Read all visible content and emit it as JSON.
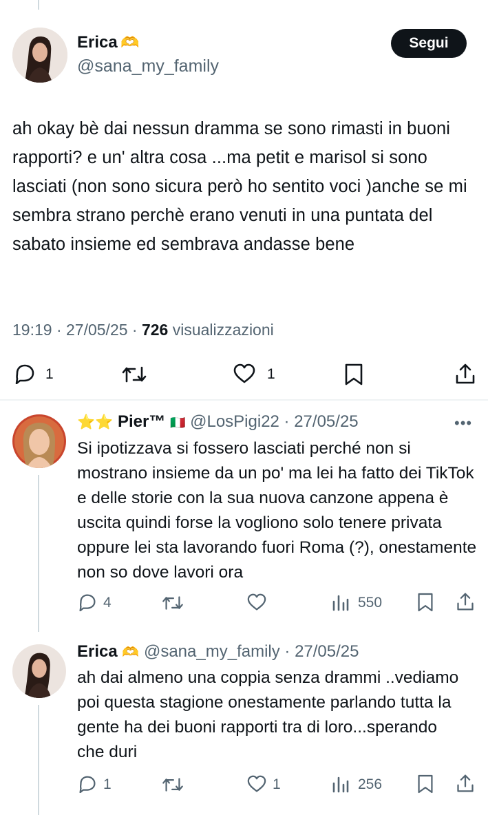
{
  "tweet": {
    "author_name": "Erica",
    "author_emoji": "🫶",
    "handle": "@sana_my_family",
    "follow_label": "Segui",
    "text": "ah okay bè dai nessun dramma se sono rimasti in buoni rapporti? e un' altra cosa ...ma petit e marisol si sono lasciati (non sono sicura però ho sentito voci )anche se mi sembra strano perchè erano venuti in una puntata del sabato insieme ed sembrava andasse bene",
    "time": "19:19 · 27/05/25 · ",
    "views_count": "726",
    "views_label": " visualizzazioni",
    "replies": "1",
    "likes": "1"
  },
  "reply1": {
    "stars": "⭐⭐",
    "author_name": "Pier™",
    "flag": "🇮🇹",
    "handle_date": "@LosPigi22 · 27/05/25",
    "more": "•••",
    "text": "Si ipotizzava si fossero lasciati perché non si mostrano insieme da un po' ma lei ha fatto dei TikTok e delle storie con la sua nuova canzone appena è uscita quindi forse la vogliono solo tenere privata oppure lei sta lavorando fuori Roma (?), onestamente non so dove lavori ora",
    "replies": "4",
    "views": "550"
  },
  "reply2": {
    "author_name": "Erica",
    "author_emoji": "🫶",
    "handle_date": "@sana_my_family · 27/05/25",
    "text": "ah dai almeno una coppia senza drammi ..vediamo poi questa stagione onestamente parlando tutta la gente ha dei buoni rapporti tra di loro...sperando che duri",
    "replies": "1",
    "likes": "1",
    "views": "256"
  },
  "icons": {
    "reply": "reply-icon",
    "retweet": "retweet-icon",
    "like": "heart-icon",
    "bookmark": "bookmark-icon",
    "share": "share-icon",
    "views": "views-icon"
  },
  "colors": {
    "text": "#0f1419",
    "secondary": "#536471",
    "follow_bg": "#0f1419"
  }
}
